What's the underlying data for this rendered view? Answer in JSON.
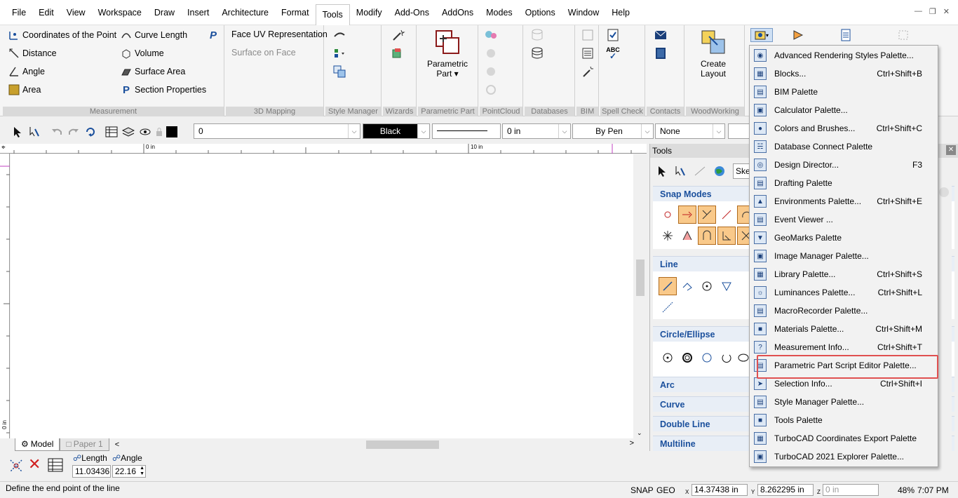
{
  "menu": {
    "items": [
      "File",
      "Edit",
      "View",
      "Workspace",
      "Draw",
      "Insert",
      "Architecture",
      "Format",
      "Tools",
      "Modify",
      "Add-Ons",
      "AddOns",
      "Modes",
      "Options",
      "Window",
      "Help"
    ],
    "active": "Tools"
  },
  "ribbon": {
    "measurement": {
      "label": "Measurement",
      "coordinates": "Coordinates of the Point",
      "distance": "Distance",
      "angle": "Angle",
      "area": "Area",
      "curve_length": "Curve Length",
      "volume": "Volume",
      "surface_area": "Surface Area",
      "section_properties": "Section Properties"
    },
    "mapping": {
      "label": "3D Mapping",
      "face_uv": "Face UV Representation",
      "surface_on_face": "Surface on Face"
    },
    "style_manager": {
      "label": "Style Manager"
    },
    "wizards": {
      "label": "Wizards"
    },
    "parametric_part": {
      "label": "Parametric Part",
      "button_line1": "Parametric",
      "button_line2": "Part"
    },
    "pointcloud": {
      "label": "PointCloud"
    },
    "databases": {
      "label": "Databases"
    },
    "bim": {
      "label": "BIM"
    },
    "spell_check": {
      "label": "Spell Check"
    },
    "contacts": {
      "label": "Contacts"
    },
    "woodworking": {
      "label": "WoodWorking",
      "create_line1": "Create",
      "create_line2": "Layout"
    }
  },
  "toolbar": {
    "layer_value": "0",
    "color_value": "Black",
    "width_value": "0 in",
    "pen_value": "By Pen",
    "fill_value": "None"
  },
  "rulers": {
    "mark0": "0 in",
    "mark10": "10 in",
    "left0": "0 in"
  },
  "tabs": {
    "model": "Model",
    "paper": "Paper 1"
  },
  "inspector": {
    "length_label": "Length",
    "angle_label": "Angle",
    "length_value": "11.03436",
    "angle_value": "22.16"
  },
  "status": {
    "message": "Define the end point of the line",
    "snap": "SNAP",
    "geo": "GEO",
    "x_label": "X",
    "y_label": "Y",
    "z_label": "Z",
    "x_value": "14.37438 in",
    "y_value": "8.262295 in",
    "z_value": "0 in",
    "zoom": "48%",
    "time": "7:07 PM"
  },
  "palette": {
    "title": "Tools",
    "search_value": "Sket",
    "sections": [
      "Snap Modes",
      "Line",
      "Circle/Ellipse",
      "Arc",
      "Curve",
      "Double Line",
      "Multiline"
    ]
  },
  "dropdown": {
    "items": [
      {
        "label": "Advanced Rendering Styles Palette...",
        "shortcut": ""
      },
      {
        "label": "Blocks...",
        "shortcut": "Ctrl+Shift+B"
      },
      {
        "label": "BIM Palette",
        "shortcut": ""
      },
      {
        "label": "Calculator Palette...",
        "shortcut": ""
      },
      {
        "label": "Colors and Brushes...",
        "shortcut": "Ctrl+Shift+C"
      },
      {
        "label": "Database Connect Palette",
        "shortcut": ""
      },
      {
        "label": "Design Director...",
        "shortcut": "F3"
      },
      {
        "label": "Drafting Palette",
        "shortcut": ""
      },
      {
        "label": "Environments Palette...",
        "shortcut": "Ctrl+Shift+E"
      },
      {
        "label": "Event Viewer ...",
        "shortcut": ""
      },
      {
        "label": "GeoMarks Palette",
        "shortcut": ""
      },
      {
        "label": "Image Manager Palette...",
        "shortcut": ""
      },
      {
        "label": "Library Palette...",
        "shortcut": "Ctrl+Shift+S"
      },
      {
        "label": "Luminances Palette...",
        "shortcut": "Ctrl+Shift+L"
      },
      {
        "label": "MacroRecorder Palette...",
        "shortcut": ""
      },
      {
        "label": "Materials Palette...",
        "shortcut": "Ctrl+Shift+M"
      },
      {
        "label": "Measurement Info...",
        "shortcut": "Ctrl+Shift+T"
      },
      {
        "label": "Parametric Part Script Editor Palette...",
        "shortcut": ""
      },
      {
        "label": "Selection Info...",
        "shortcut": "Ctrl+Shift+I"
      },
      {
        "label": "Style Manager Palette...",
        "shortcut": ""
      },
      {
        "label": "Tools Palette",
        "shortcut": ""
      },
      {
        "label": "TurboCAD Coordinates Export Palette",
        "shortcut": ""
      },
      {
        "label": "TurboCAD 2021 Explorer Palette...",
        "shortcut": ""
      }
    ],
    "highlighted_index": 17,
    "highlight_color": "#e05050"
  },
  "colors": {
    "accent": "#1a4f9c",
    "snap_active": "#f9c98a"
  }
}
